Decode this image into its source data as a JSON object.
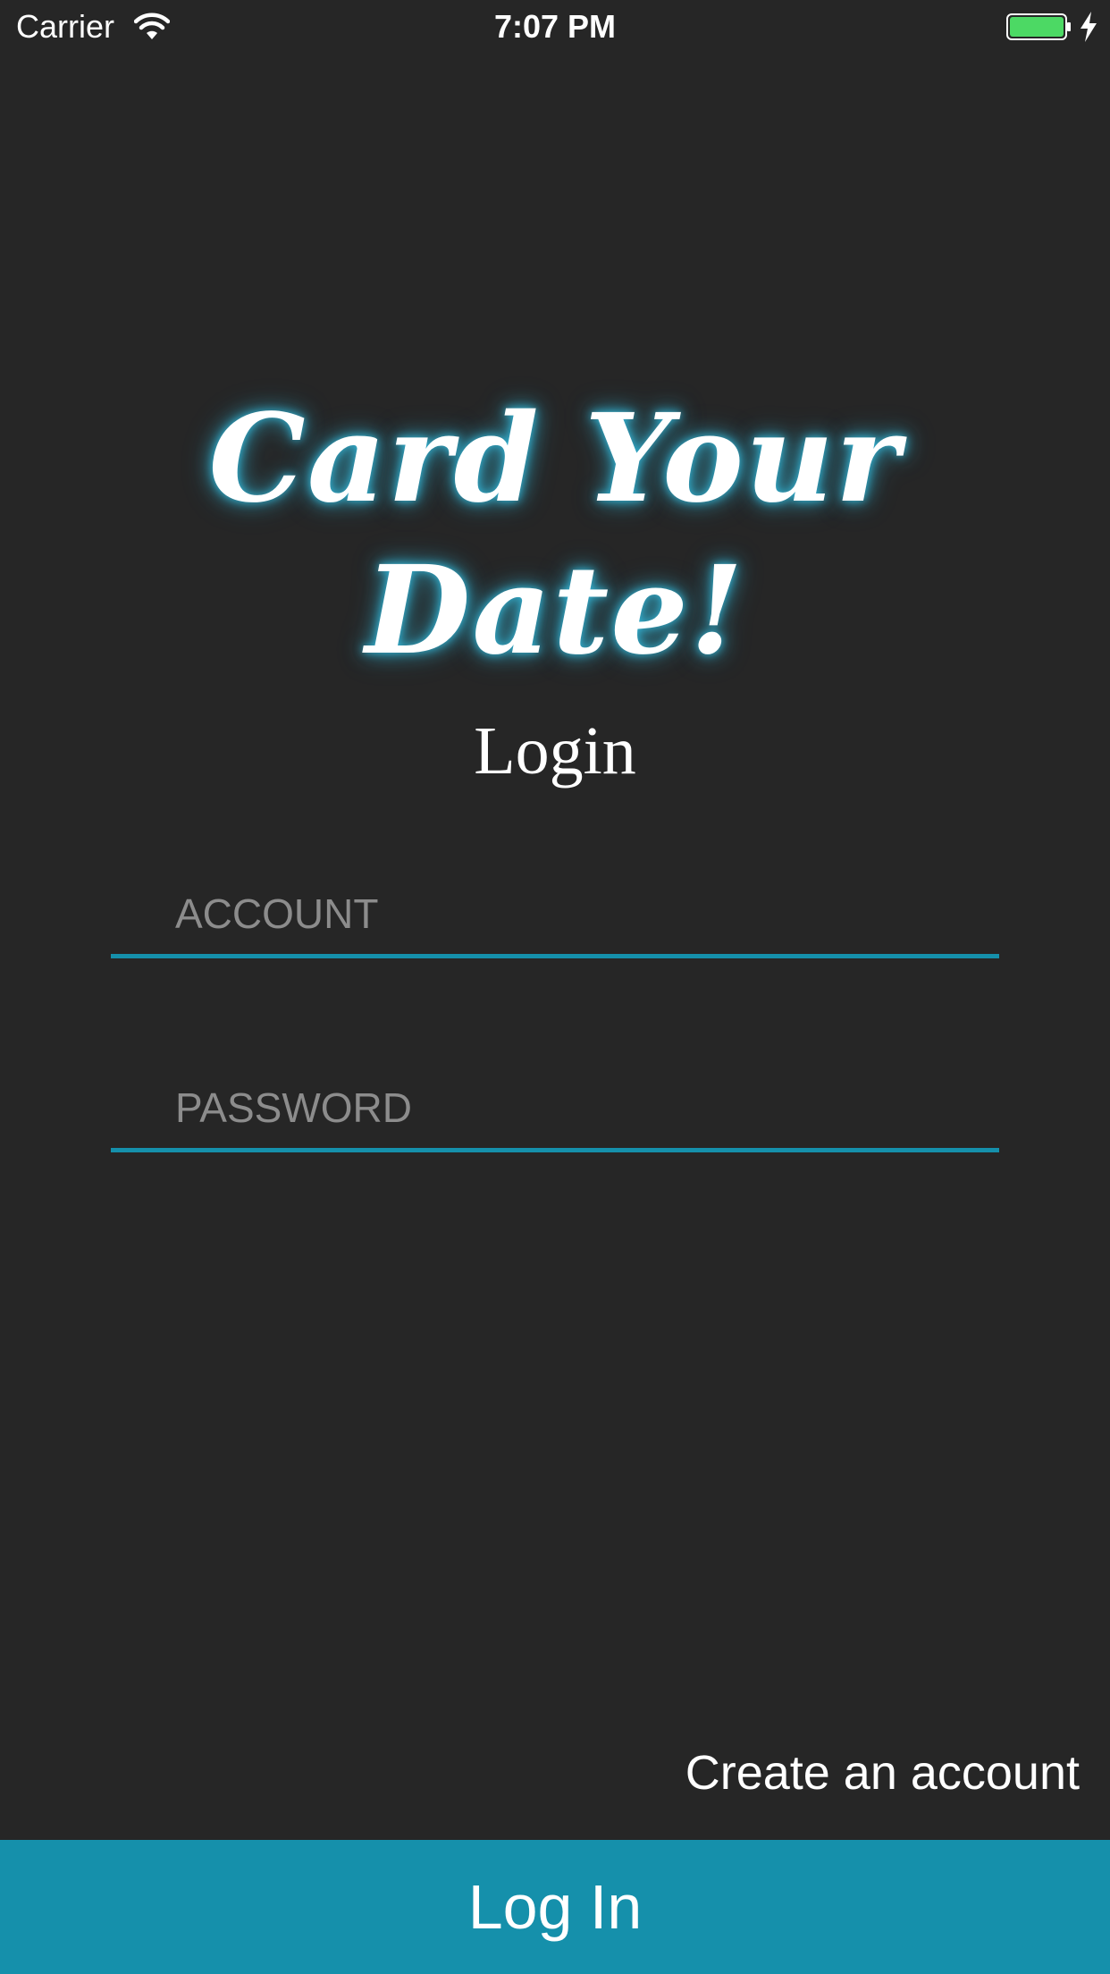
{
  "status_bar": {
    "carrier": "Carrier",
    "time": "7:07 PM",
    "icons": [
      "wifi-icon",
      "battery-icon",
      "charging-icon"
    ],
    "battery_color": "#4cd964"
  },
  "app": {
    "logo_text": "Card Your Date!",
    "heading": "Login"
  },
  "form": {
    "account_placeholder": "ACCOUNT",
    "account_value": "",
    "password_placeholder": "PASSWORD",
    "password_value": ""
  },
  "links": {
    "create_account": "Create an account"
  },
  "actions": {
    "login_label": "Log In"
  },
  "colors": {
    "background": "#262626",
    "accent": "#1590ab",
    "logo_glow": "#33b5d6",
    "placeholder": "#8c8c8c"
  }
}
